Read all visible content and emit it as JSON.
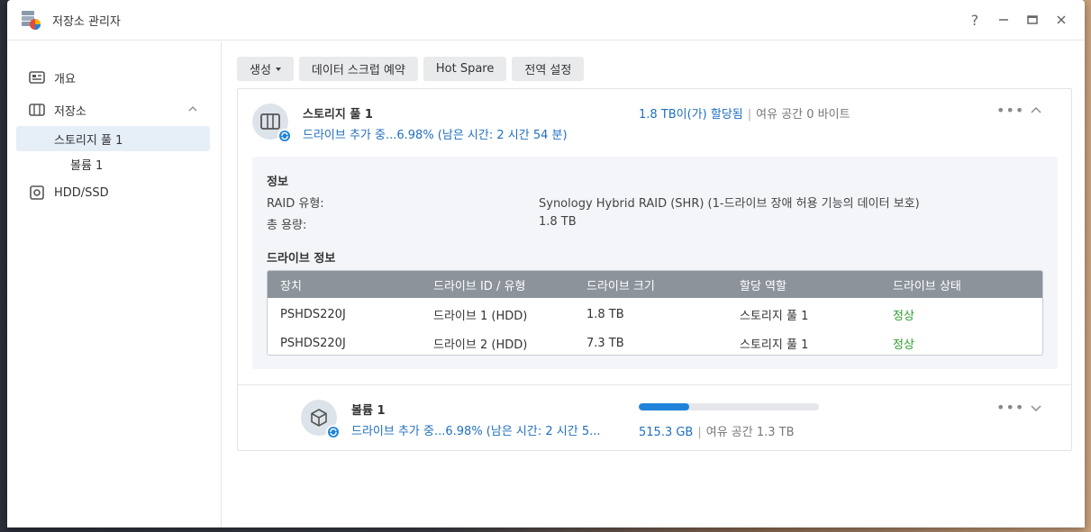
{
  "window": {
    "title": "저장소 관리자"
  },
  "controls": {
    "help": "?",
    "minimize": "—",
    "maximize": "▭",
    "close": "✕"
  },
  "sidebar": {
    "overview": "개요",
    "storage": "저장소",
    "storage_pool": "스토리지 풀 1",
    "volume": "볼륨 1",
    "hdd_ssd": "HDD/SSD"
  },
  "toolbar": {
    "create": "생성",
    "scrub": "데이터 스크럽 예약",
    "hot_spare": "Hot Spare",
    "global_settings": "전역 설정"
  },
  "pool": {
    "name": "스토리지 풀 1",
    "status": "드라이브 추가 중...6.98% (남은 시간: 2 시간 54 분)",
    "allocated": "1.8 TB이(가) 할당됨",
    "separator": "|",
    "free": "여유 공간 0 바이트",
    "more": "•••"
  },
  "info": {
    "title": "정보",
    "raid_key": "RAID 유형:",
    "raid_val": "Synology Hybrid RAID (SHR) (1-드라이브 장애 허용 기능의 데이터 보호)",
    "capacity_key": "총 용량:",
    "capacity_val": "1.8 TB",
    "drive_title": "드라이브 정보"
  },
  "drive_table": {
    "headers": [
      "장치",
      "드라이브 ID / 유형",
      "드라이브 크기",
      "할당 역할",
      "드라이브 상태"
    ],
    "rows": [
      [
        "PSHDS220J",
        "드라이브 1 (HDD)",
        "1.8 TB",
        "스토리지 풀 1",
        "정상"
      ],
      [
        "PSHDS220J",
        "드라이브 2 (HDD)",
        "7.3 TB",
        "스토리지 풀 1",
        "정상"
      ]
    ]
  },
  "volume": {
    "name": "볼륨 1",
    "status": "드라이브 추가 중...6.98% (남은 시간: 2 시간 5...",
    "used": "515.3 GB",
    "separator": "|",
    "free": "여유 공간 1.3 TB",
    "usage_fraction": 0.28,
    "more": "•••"
  },
  "colors": {
    "accent": "#1f84d9",
    "link": "#1f6fc0",
    "ok": "#2e9d2e",
    "table_header": "#8c939b"
  }
}
